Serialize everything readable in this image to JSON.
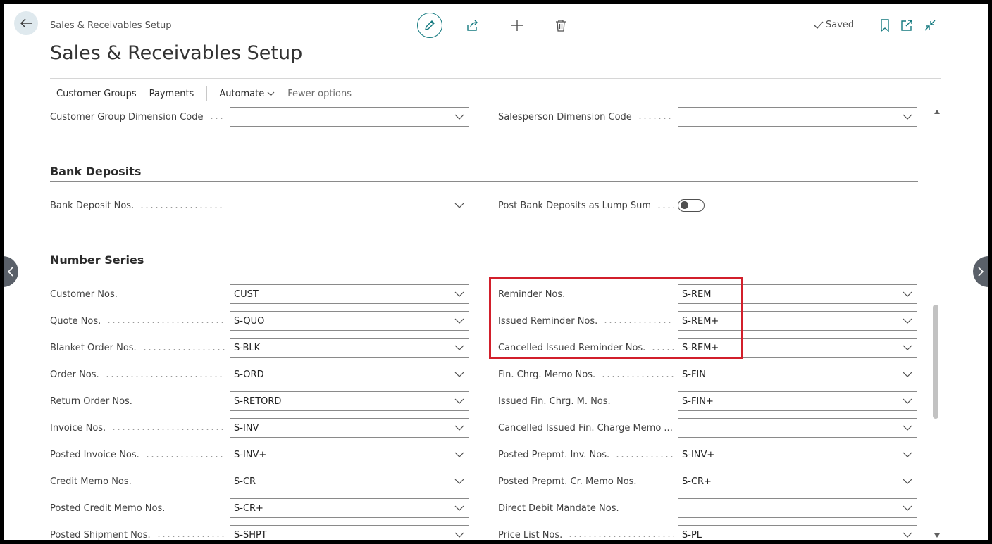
{
  "header": {
    "breadcrumb": "Sales & Receivables Setup",
    "title": "Sales & Receivables Setup",
    "saved_label": "Saved"
  },
  "actions": {
    "customer_groups": "Customer Groups",
    "payments": "Payments",
    "automate": "Automate",
    "fewer_options": "Fewer options"
  },
  "dimensions": {
    "left": {
      "label": "Customer Group Dimension Code",
      "value": ""
    },
    "right": {
      "label": "Salesperson Dimension Code",
      "value": ""
    }
  },
  "bank_deposits": {
    "title": "Bank Deposits",
    "left": {
      "label": "Bank Deposit Nos.",
      "value": ""
    },
    "right": {
      "label": "Post Bank Deposits as Lump Sum",
      "value": false
    }
  },
  "number_series": {
    "title": "Number Series",
    "left": [
      {
        "label": "Customer Nos.",
        "value": "CUST"
      },
      {
        "label": "Quote Nos.",
        "value": "S-QUO"
      },
      {
        "label": "Blanket Order Nos.",
        "value": "S-BLK"
      },
      {
        "label": "Order Nos.",
        "value": "S-ORD"
      },
      {
        "label": "Return Order Nos.",
        "value": "S-RETORD"
      },
      {
        "label": "Invoice Nos.",
        "value": "S-INV"
      },
      {
        "label": "Posted Invoice Nos.",
        "value": "S-INV+"
      },
      {
        "label": "Credit Memo Nos.",
        "value": "S-CR"
      },
      {
        "label": "Posted Credit Memo Nos.",
        "value": "S-CR+"
      },
      {
        "label": "Posted Shipment Nos.",
        "value": "S-SHPT"
      }
    ],
    "right": [
      {
        "label": "Reminder Nos.",
        "value": "S-REM"
      },
      {
        "label": "Issued Reminder Nos.",
        "value": "S-REM+"
      },
      {
        "label": "Cancelled Issued Reminder Nos.",
        "value": "S-REM+"
      },
      {
        "label": "Fin. Chrg. Memo Nos.",
        "value": "S-FIN"
      },
      {
        "label": "Issued Fin. Chrg. M. Nos.",
        "value": "S-FIN+"
      },
      {
        "label": "Cancelled Issued Fin. Charge Memo ...",
        "value": ""
      },
      {
        "label": "Posted Prepmt. Inv. Nos.",
        "value": "S-INV+"
      },
      {
        "label": "Posted Prepmt. Cr. Memo Nos.",
        "value": "S-CR+"
      },
      {
        "label": "Direct Debit Mandate Nos.",
        "value": ""
      },
      {
        "label": "Price List Nos.",
        "value": "S-PL"
      }
    ]
  },
  "colors": {
    "accent": "#13797f",
    "highlight": "#d21f2b"
  }
}
